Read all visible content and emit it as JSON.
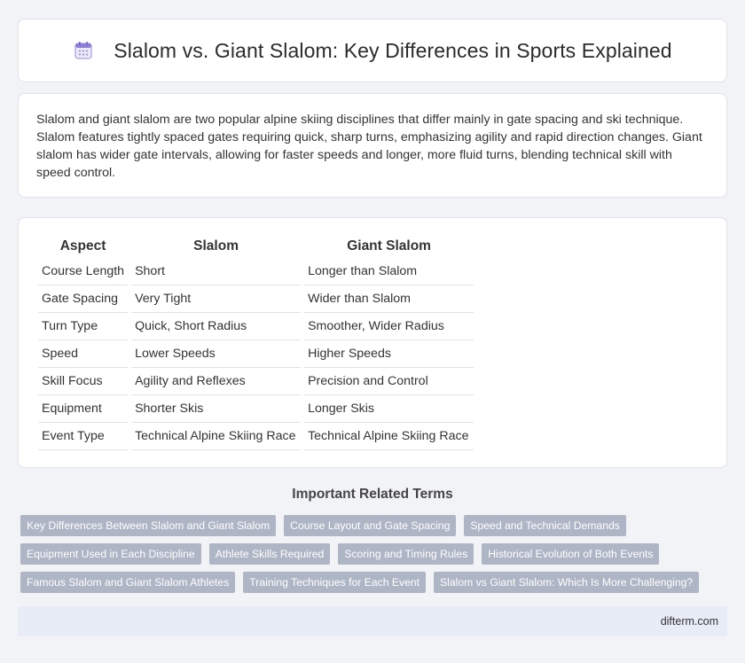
{
  "header": {
    "icon": "calendar-icon",
    "title": "Slalom vs. Giant Slalom: Key Differences in Sports Explained"
  },
  "intro": {
    "text": "Slalom and giant slalom are two popular alpine skiing disciplines that differ mainly in gate spacing and ski technique. Slalom features tightly spaced gates requiring quick, sharp turns, emphasizing agility and rapid direction changes. Giant slalom has wider gate intervals, allowing for faster speeds and longer, more fluid turns, blending technical skill with speed control."
  },
  "comparison": {
    "headers": [
      "Aspect",
      "Slalom",
      "Giant Slalom"
    ],
    "rows": [
      [
        "Course Length",
        "Short",
        "Longer than Slalom"
      ],
      [
        "Gate Spacing",
        "Very Tight",
        "Wider than Slalom"
      ],
      [
        "Turn Type",
        "Quick, Short Radius",
        "Smoother, Wider Radius"
      ],
      [
        "Speed",
        "Lower Speeds",
        "Higher Speeds"
      ],
      [
        "Skill Focus",
        "Agility and Reflexes",
        "Precision and Control"
      ],
      [
        "Equipment",
        "Shorter Skis",
        "Longer Skis"
      ],
      [
        "Event Type",
        "Technical Alpine Skiing Race",
        "Technical Alpine Skiing Race"
      ]
    ]
  },
  "related": {
    "title": "Important Related Terms",
    "tags": [
      "Key Differences Between Slalom and Giant Slalom",
      "Course Layout and Gate Spacing",
      "Speed and Technical Demands",
      "Equipment Used in Each Discipline",
      "Athlete Skills Required",
      "Scoring and Timing Rules",
      "Historical Evolution of Both Events",
      "Famous Slalom and Giant Slalom Athletes",
      "Training Techniques for Each Event",
      "Slalom vs Giant Slalom: Which Is More Challenging?"
    ]
  },
  "footer": {
    "domain": "difterm.com"
  },
  "colors": {
    "background": "#f1f3f7",
    "tag_background": "#aeb5c5",
    "footer_background": "#e7ecf6",
    "icon_accent": "#8b7fd6"
  }
}
